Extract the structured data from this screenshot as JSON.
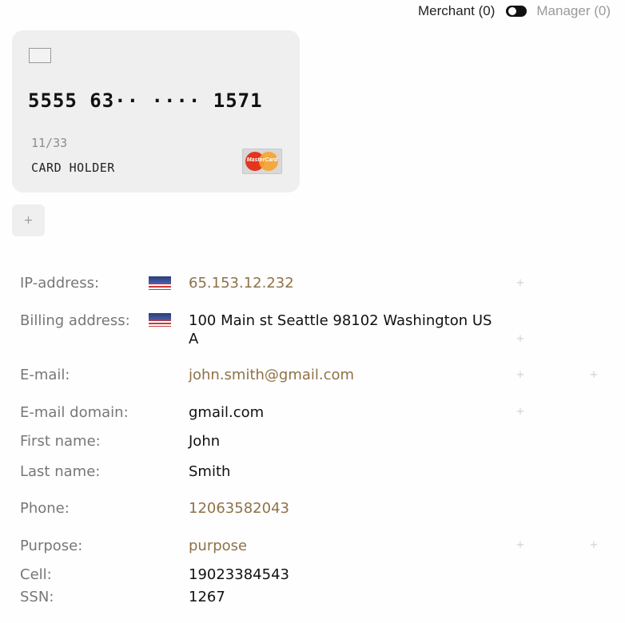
{
  "header": {
    "merchant_label": "Merchant (0)",
    "manager_label": "Manager (0)"
  },
  "card": {
    "number": "5555 63·· ···· 1571",
    "expiry": "11/33",
    "holder": "CARD HOLDER",
    "brand_text": "MasterCard"
  },
  "add_card_icon": "+",
  "fields": {
    "ip": {
      "label": "IP-address:",
      "value": "65.153.12.232"
    },
    "billing": {
      "label": "Billing address:",
      "value": "100 Main st Seattle 98102 Washington USA"
    },
    "email": {
      "label": "E-mail:",
      "value": "john.smith@gmail.com"
    },
    "email_domain": {
      "label": "E-mail domain:",
      "value": "gmail.com"
    },
    "first_name": {
      "label": "First name:",
      "value": "John"
    },
    "last_name": {
      "label": "Last name:",
      "value": "Smith"
    },
    "phone": {
      "label": "Phone:",
      "value": "12063582043"
    },
    "purpose": {
      "label": "Purpose:",
      "value": "purpose"
    },
    "cell": {
      "label": "Cell:",
      "value": "19023384543"
    },
    "ssn": {
      "label": "SSN:",
      "value": "1267"
    }
  },
  "plus_symbol": "+",
  "colors": {
    "link": "#8f7248",
    "label": "#777777",
    "card_bg": "#efefef"
  },
  "icons": {
    "flag": "us-flag-icon",
    "add": "plus-icon"
  }
}
